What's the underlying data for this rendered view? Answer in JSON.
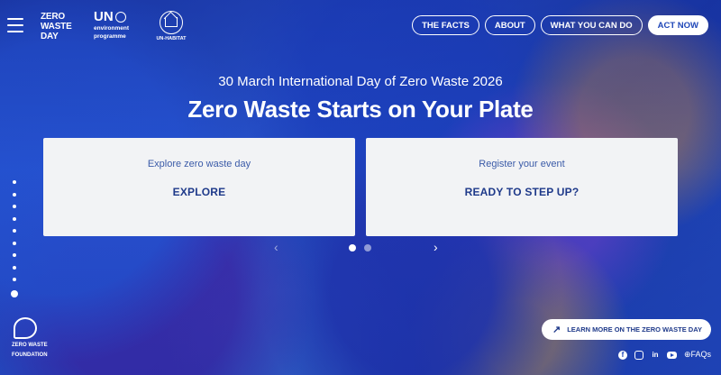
{
  "header": {
    "zw_logo_lines": [
      "ZERO",
      "WASTE",
      "DAY"
    ],
    "unep_logo": {
      "un": "UN",
      "sub_lines": [
        "environment",
        "programme"
      ]
    },
    "habitat_logo": "UN-HABITAT",
    "nav": [
      {
        "label": "THE FACTS"
      },
      {
        "label": "ABOUT"
      },
      {
        "label": "WHAT YOU CAN DO"
      },
      {
        "label": "ACT NOW"
      }
    ]
  },
  "hero": {
    "subtitle": "30 March International Day of Zero Waste 2026",
    "title": "Zero Waste Starts on Your Plate"
  },
  "cards": [
    {
      "text": "Explore zero waste day",
      "cta": "EXPLORE"
    },
    {
      "text": "Register your event",
      "cta": "READY TO STEP UP?"
    }
  ],
  "carousel": {
    "prev": "‹",
    "next": "›",
    "dots": 2,
    "active": 1
  },
  "side_nav": {
    "dots": 10,
    "active": 10
  },
  "footer": {
    "foundation_lines": [
      "ZERO WASTE",
      "FOUNDATION"
    ],
    "learn_more": "LEARN MORE ON THE ZERO WASTE DAY",
    "learn_more_icon": "arrow-up-right-icon",
    "social": {
      "fb": "f",
      "li": "in"
    },
    "faqs": "FAQs"
  },
  "colors": {
    "primary": "#1f47b8",
    "card_bg": "#f2f3f5",
    "card_text": "#1f3a8a"
  }
}
